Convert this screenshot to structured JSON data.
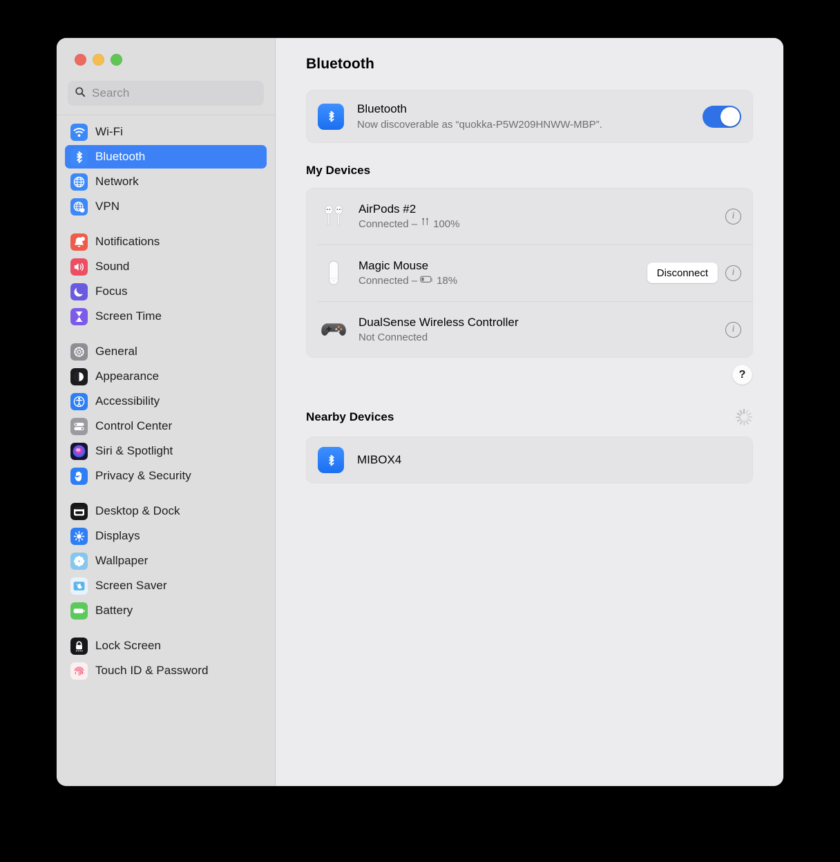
{
  "window": {
    "traffic_lights": [
      "close",
      "minimize",
      "zoom"
    ]
  },
  "sidebar": {
    "search": {
      "placeholder": "Search",
      "value": ""
    },
    "groups": [
      {
        "items": [
          {
            "label": "Wi-Fi",
            "icon": "wifi-icon",
            "selected": false
          },
          {
            "label": "Bluetooth",
            "icon": "bluetooth-icon",
            "selected": true
          },
          {
            "label": "Network",
            "icon": "network-globe-icon",
            "selected": false
          },
          {
            "label": "VPN",
            "icon": "vpn-globe-shield-icon",
            "selected": false
          }
        ]
      },
      {
        "items": [
          {
            "label": "Notifications",
            "icon": "bell-icon",
            "selected": false
          },
          {
            "label": "Sound",
            "icon": "speaker-icon",
            "selected": false
          },
          {
            "label": "Focus",
            "icon": "moon-icon",
            "selected": false
          },
          {
            "label": "Screen Time",
            "icon": "hourglass-icon",
            "selected": false
          }
        ]
      },
      {
        "items": [
          {
            "label": "General",
            "icon": "gear-icon",
            "selected": false
          },
          {
            "label": "Appearance",
            "icon": "appearance-contrast-icon",
            "selected": false
          },
          {
            "label": "Accessibility",
            "icon": "accessibility-icon",
            "selected": false
          },
          {
            "label": "Control Center",
            "icon": "control-center-icon",
            "selected": false
          },
          {
            "label": "Siri & Spotlight",
            "icon": "siri-icon",
            "selected": false
          },
          {
            "label": "Privacy & Security",
            "icon": "hand-privacy-icon",
            "selected": false
          }
        ]
      },
      {
        "items": [
          {
            "label": "Desktop & Dock",
            "icon": "desktop-dock-icon",
            "selected": false
          },
          {
            "label": "Displays",
            "icon": "brightness-icon",
            "selected": false
          },
          {
            "label": "Wallpaper",
            "icon": "wallpaper-flower-icon",
            "selected": false
          },
          {
            "label": "Screen Saver",
            "icon": "screen-saver-icon",
            "selected": false
          },
          {
            "label": "Battery",
            "icon": "battery-icon",
            "selected": false
          }
        ]
      },
      {
        "items": [
          {
            "label": "Lock Screen",
            "icon": "lock-icon",
            "selected": false
          },
          {
            "label": "Touch ID & Password",
            "icon": "fingerprint-icon",
            "selected": false
          }
        ]
      }
    ]
  },
  "main": {
    "title": "Bluetooth",
    "bluetooth_card": {
      "name": "Bluetooth",
      "status": "Now discoverable as “quokka-P5W209HNWW-MBP”.",
      "toggle_on": true,
      "icon": "bluetooth-icon"
    },
    "my_devices": {
      "title": "My Devices",
      "devices": [
        {
          "name": "AirPods #2",
          "status_prefix": "Connected – ",
          "battery": "100%",
          "battery_icon": "airpods-battery-icon",
          "icon": "airpods-icon",
          "action": null,
          "info": "info-icon"
        },
        {
          "name": "Magic Mouse",
          "status_prefix": "Connected – ",
          "battery": "18%",
          "battery_icon": "battery-low-icon",
          "icon": "magic-mouse-icon",
          "action": "Disconnect",
          "info": "info-icon"
        },
        {
          "name": "DualSense Wireless Controller",
          "status_prefix": "Not Connected",
          "battery": "",
          "battery_icon": "",
          "icon": "gamepad-icon",
          "action": null,
          "info": "info-icon"
        }
      ]
    },
    "help_button": "?",
    "nearby": {
      "title": "Nearby Devices",
      "spinner": "loading-spinner",
      "devices": [
        {
          "name": "MIBOX4",
          "icon": "bluetooth-icon"
        }
      ]
    }
  },
  "colors": {
    "accent_blue": "#3C82F6",
    "toggle_blue": "#2F72E8",
    "window_bg": "#ECECEE",
    "sidebar_bg": "#DEDEDF",
    "card_bg": "#E4E4E6"
  }
}
